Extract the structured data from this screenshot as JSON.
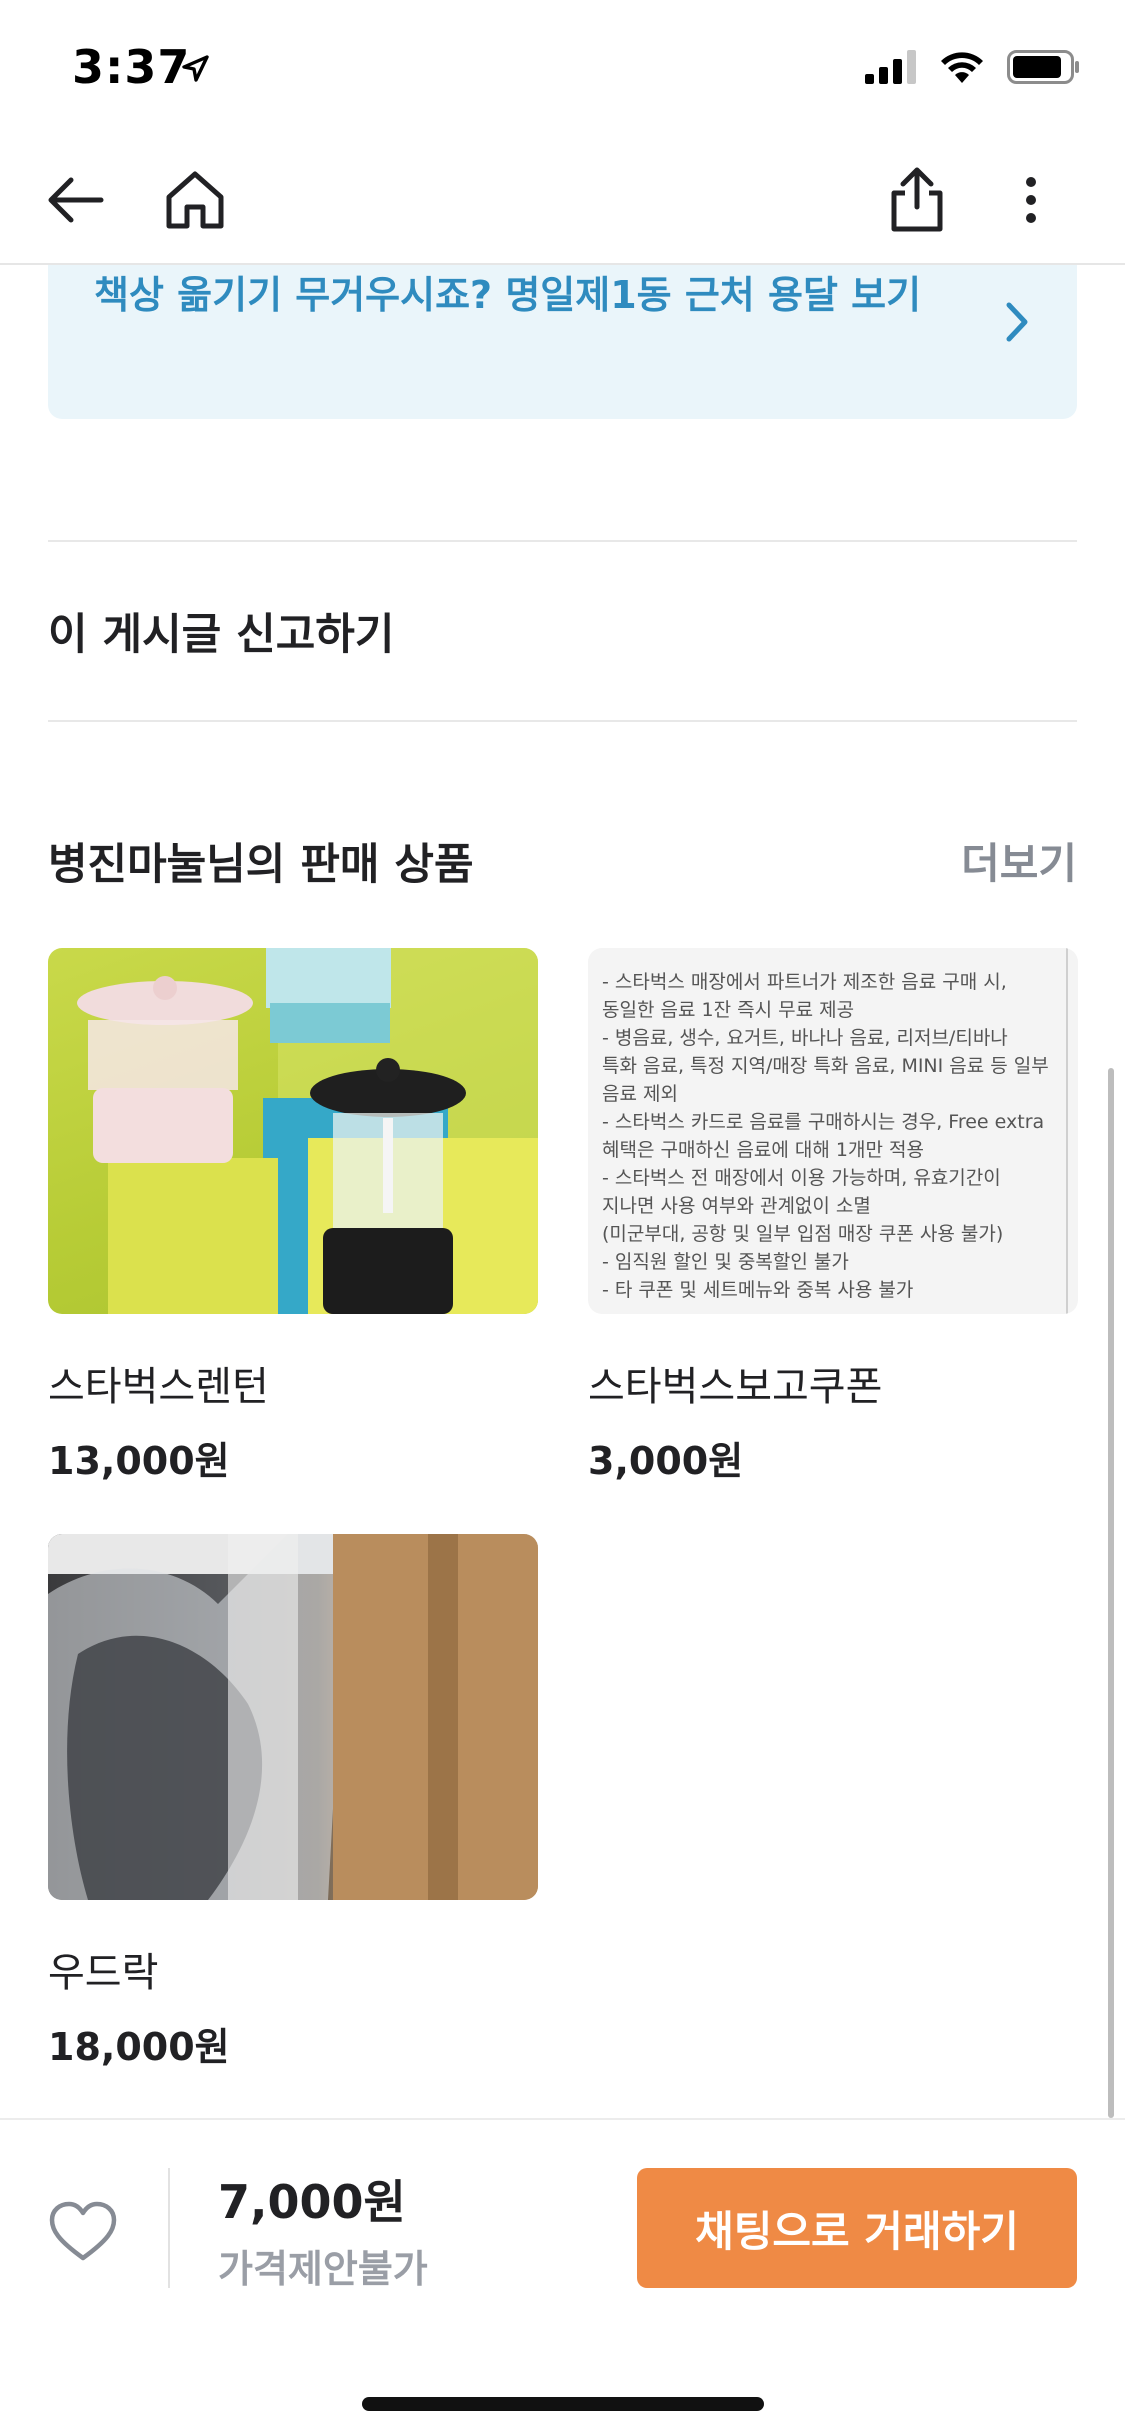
{
  "status_bar": {
    "time": "3:37",
    "icons": [
      "location-arrow-icon",
      "cellular-signal-icon",
      "wifi-icon",
      "battery-icon"
    ]
  },
  "nav": {
    "icons": [
      "back-arrow-icon",
      "home-icon",
      "share-icon",
      "more-vertical-icon"
    ]
  },
  "banner": {
    "text": "책상 옮기기 무거우시죠? 명일제1동 근처 용달 보기",
    "accent_color": "#2f8bbf",
    "background_color": "#eaf5fa"
  },
  "report_link": "이 게시글 신고하기",
  "seller_section": {
    "title": "병진마눌님의 판매 상품",
    "more": "더보기",
    "products": [
      {
        "name": "스타벅스렌턴",
        "price": "13,000원",
        "image": "lantern-photo"
      },
      {
        "name": "스타벅스보고쿠폰",
        "price": "3,000원",
        "image": "coupon-notice-photo"
      },
      {
        "name": "우드락",
        "price": "18,000원",
        "image": "wrapped-rack-photo"
      }
    ],
    "coupon_image_text": [
      "- 스타벅스 매장에서 파트너가 제조한 음료 구매 시,",
      "동일한 음료 1잔 즉시 무료 제공",
      "- 병음료, 생수, 요거트, 바나나 음료, 리저브/티바나",
      "특화 음료, 특정 지역/매장 특화 음료, MINI 음료 등 일부",
      "음료 제외",
      "- 스타벅스 카드로 음료를 구매하시는 경우, Free extra",
      "혜택은 구매하신 음료에 대해 1개만 적용",
      "- 스타벅스 전 매장에서 이용 가능하며, 유효기간이",
      "지나면 사용 여부와 관계없이 소멸",
      "(미군부대, 공항 및 일부 입점 매장 쿠폰 사용 불가)",
      "- 임직원 할인 및 중복할인 불가",
      "- 타 쿠폰 및 세트메뉴와 중복 사용 불가"
    ]
  },
  "bottom_bar": {
    "price": "7,000원",
    "negotiation": "가격제안불가",
    "chat_button": "채팅으로 거래하기",
    "chat_button_color": "#ef8a45",
    "like_icon": "heart-outline-icon"
  }
}
